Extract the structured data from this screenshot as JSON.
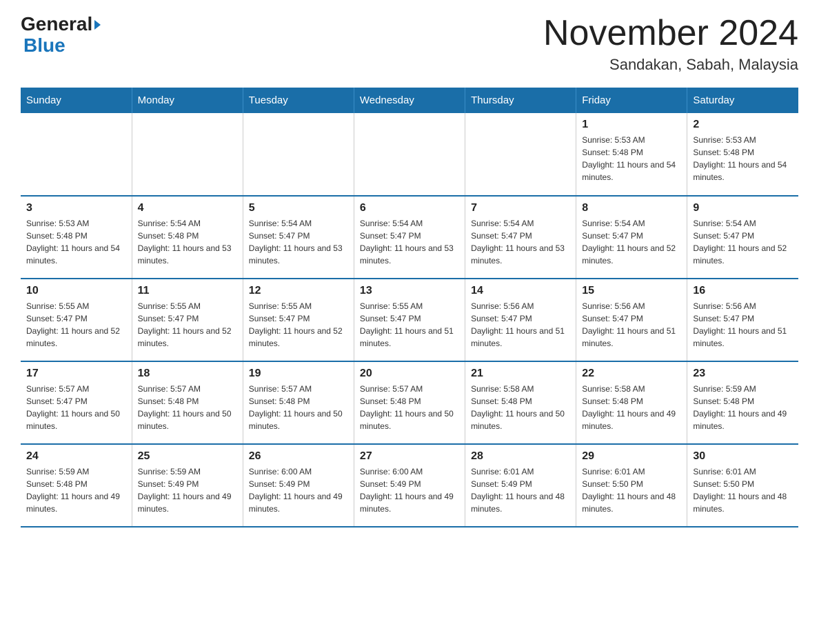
{
  "header": {
    "logo_general": "General",
    "logo_blue": "Blue",
    "month_title": "November 2024",
    "location": "Sandakan, Sabah, Malaysia"
  },
  "weekdays": [
    "Sunday",
    "Monday",
    "Tuesday",
    "Wednesday",
    "Thursday",
    "Friday",
    "Saturday"
  ],
  "weeks": [
    {
      "days": [
        {
          "number": "",
          "sunrise": "",
          "sunset": "",
          "daylight": ""
        },
        {
          "number": "",
          "sunrise": "",
          "sunset": "",
          "daylight": ""
        },
        {
          "number": "",
          "sunrise": "",
          "sunset": "",
          "daylight": ""
        },
        {
          "number": "",
          "sunrise": "",
          "sunset": "",
          "daylight": ""
        },
        {
          "number": "",
          "sunrise": "",
          "sunset": "",
          "daylight": ""
        },
        {
          "number": "1",
          "sunrise": "Sunrise: 5:53 AM",
          "sunset": "Sunset: 5:48 PM",
          "daylight": "Daylight: 11 hours and 54 minutes."
        },
        {
          "number": "2",
          "sunrise": "Sunrise: 5:53 AM",
          "sunset": "Sunset: 5:48 PM",
          "daylight": "Daylight: 11 hours and 54 minutes."
        }
      ]
    },
    {
      "days": [
        {
          "number": "3",
          "sunrise": "Sunrise: 5:53 AM",
          "sunset": "Sunset: 5:48 PM",
          "daylight": "Daylight: 11 hours and 54 minutes."
        },
        {
          "number": "4",
          "sunrise": "Sunrise: 5:54 AM",
          "sunset": "Sunset: 5:48 PM",
          "daylight": "Daylight: 11 hours and 53 minutes."
        },
        {
          "number": "5",
          "sunrise": "Sunrise: 5:54 AM",
          "sunset": "Sunset: 5:47 PM",
          "daylight": "Daylight: 11 hours and 53 minutes."
        },
        {
          "number": "6",
          "sunrise": "Sunrise: 5:54 AM",
          "sunset": "Sunset: 5:47 PM",
          "daylight": "Daylight: 11 hours and 53 minutes."
        },
        {
          "number": "7",
          "sunrise": "Sunrise: 5:54 AM",
          "sunset": "Sunset: 5:47 PM",
          "daylight": "Daylight: 11 hours and 53 minutes."
        },
        {
          "number": "8",
          "sunrise": "Sunrise: 5:54 AM",
          "sunset": "Sunset: 5:47 PM",
          "daylight": "Daylight: 11 hours and 52 minutes."
        },
        {
          "number": "9",
          "sunrise": "Sunrise: 5:54 AM",
          "sunset": "Sunset: 5:47 PM",
          "daylight": "Daylight: 11 hours and 52 minutes."
        }
      ]
    },
    {
      "days": [
        {
          "number": "10",
          "sunrise": "Sunrise: 5:55 AM",
          "sunset": "Sunset: 5:47 PM",
          "daylight": "Daylight: 11 hours and 52 minutes."
        },
        {
          "number": "11",
          "sunrise": "Sunrise: 5:55 AM",
          "sunset": "Sunset: 5:47 PM",
          "daylight": "Daylight: 11 hours and 52 minutes."
        },
        {
          "number": "12",
          "sunrise": "Sunrise: 5:55 AM",
          "sunset": "Sunset: 5:47 PM",
          "daylight": "Daylight: 11 hours and 52 minutes."
        },
        {
          "number": "13",
          "sunrise": "Sunrise: 5:55 AM",
          "sunset": "Sunset: 5:47 PM",
          "daylight": "Daylight: 11 hours and 51 minutes."
        },
        {
          "number": "14",
          "sunrise": "Sunrise: 5:56 AM",
          "sunset": "Sunset: 5:47 PM",
          "daylight": "Daylight: 11 hours and 51 minutes."
        },
        {
          "number": "15",
          "sunrise": "Sunrise: 5:56 AM",
          "sunset": "Sunset: 5:47 PM",
          "daylight": "Daylight: 11 hours and 51 minutes."
        },
        {
          "number": "16",
          "sunrise": "Sunrise: 5:56 AM",
          "sunset": "Sunset: 5:47 PM",
          "daylight": "Daylight: 11 hours and 51 minutes."
        }
      ]
    },
    {
      "days": [
        {
          "number": "17",
          "sunrise": "Sunrise: 5:57 AM",
          "sunset": "Sunset: 5:47 PM",
          "daylight": "Daylight: 11 hours and 50 minutes."
        },
        {
          "number": "18",
          "sunrise": "Sunrise: 5:57 AM",
          "sunset": "Sunset: 5:48 PM",
          "daylight": "Daylight: 11 hours and 50 minutes."
        },
        {
          "number": "19",
          "sunrise": "Sunrise: 5:57 AM",
          "sunset": "Sunset: 5:48 PM",
          "daylight": "Daylight: 11 hours and 50 minutes."
        },
        {
          "number": "20",
          "sunrise": "Sunrise: 5:57 AM",
          "sunset": "Sunset: 5:48 PM",
          "daylight": "Daylight: 11 hours and 50 minutes."
        },
        {
          "number": "21",
          "sunrise": "Sunrise: 5:58 AM",
          "sunset": "Sunset: 5:48 PM",
          "daylight": "Daylight: 11 hours and 50 minutes."
        },
        {
          "number": "22",
          "sunrise": "Sunrise: 5:58 AM",
          "sunset": "Sunset: 5:48 PM",
          "daylight": "Daylight: 11 hours and 49 minutes."
        },
        {
          "number": "23",
          "sunrise": "Sunrise: 5:59 AM",
          "sunset": "Sunset: 5:48 PM",
          "daylight": "Daylight: 11 hours and 49 minutes."
        }
      ]
    },
    {
      "days": [
        {
          "number": "24",
          "sunrise": "Sunrise: 5:59 AM",
          "sunset": "Sunset: 5:48 PM",
          "daylight": "Daylight: 11 hours and 49 minutes."
        },
        {
          "number": "25",
          "sunrise": "Sunrise: 5:59 AM",
          "sunset": "Sunset: 5:49 PM",
          "daylight": "Daylight: 11 hours and 49 minutes."
        },
        {
          "number": "26",
          "sunrise": "Sunrise: 6:00 AM",
          "sunset": "Sunset: 5:49 PM",
          "daylight": "Daylight: 11 hours and 49 minutes."
        },
        {
          "number": "27",
          "sunrise": "Sunrise: 6:00 AM",
          "sunset": "Sunset: 5:49 PM",
          "daylight": "Daylight: 11 hours and 49 minutes."
        },
        {
          "number": "28",
          "sunrise": "Sunrise: 6:01 AM",
          "sunset": "Sunset: 5:49 PM",
          "daylight": "Daylight: 11 hours and 48 minutes."
        },
        {
          "number": "29",
          "sunrise": "Sunrise: 6:01 AM",
          "sunset": "Sunset: 5:50 PM",
          "daylight": "Daylight: 11 hours and 48 minutes."
        },
        {
          "number": "30",
          "sunrise": "Sunrise: 6:01 AM",
          "sunset": "Sunset: 5:50 PM",
          "daylight": "Daylight: 11 hours and 48 minutes."
        }
      ]
    }
  ]
}
